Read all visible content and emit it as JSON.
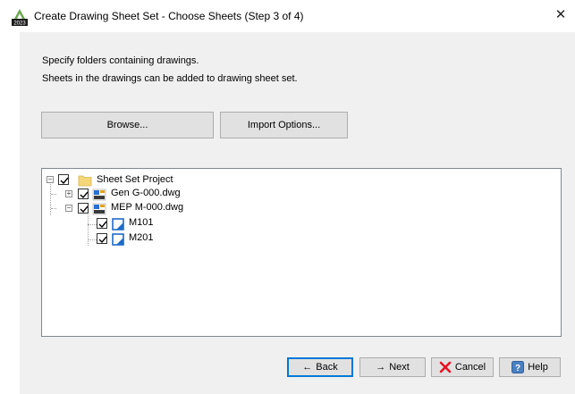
{
  "window": {
    "title": "Create Drawing Sheet Set - Choose Sheets (Step 3 of 4)",
    "app_icon_badge": "2023",
    "close_glyph": "✕"
  },
  "instructions": {
    "line1": "Specify folders containing drawings.",
    "line2": "Sheets in the drawings can be added to drawing sheet set."
  },
  "buttons": {
    "browse": "Browse...",
    "import_options": "Import Options..."
  },
  "tree": [
    {
      "label": "Sheet Set Project",
      "icon": "folder-icon",
      "checked": true,
      "expander": "minus"
    },
    {
      "label": "Gen G-000.dwg",
      "icon": "dwg-file-icon",
      "checked": true,
      "expander": "plus"
    },
    {
      "label": "MEP M-000.dwg",
      "icon": "dwg-file-icon",
      "checked": true,
      "expander": "minus"
    },
    {
      "label": "M101",
      "icon": "layout-sheet-icon",
      "checked": true
    },
    {
      "label": "M201",
      "icon": "layout-sheet-icon",
      "checked": true
    }
  ],
  "footer": {
    "back": "Back",
    "next": "Next",
    "cancel": "Cancel",
    "help": "Help"
  },
  "colors": {
    "dialog_bg": "#f0f0f0",
    "accent": "#0078d7",
    "cancel_icon": "#e81123",
    "help_icon": "#4a7fc1",
    "folder": "#f5d77a"
  }
}
